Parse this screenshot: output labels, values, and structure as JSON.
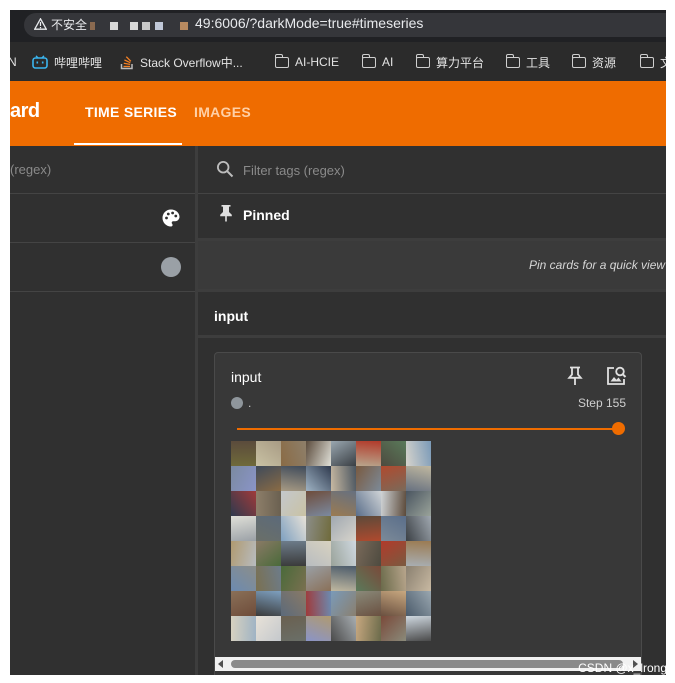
{
  "browser": {
    "security_label": "不安全",
    "url_text": "49:6006/?darkMode=true#timeseries",
    "bookmarks": [
      {
        "label": "N",
        "icon": "partial-icon"
      },
      {
        "label": "哔哩哔哩",
        "icon": "bilibili-icon"
      },
      {
        "label": "Stack Overflow中...",
        "icon": "stackoverflow-icon"
      },
      {
        "label": "AI-HCIE",
        "icon": "folder-icon"
      },
      {
        "label": "AI",
        "icon": "folder-icon"
      },
      {
        "label": "算力平台",
        "icon": "folder-icon"
      },
      {
        "label": "工具",
        "icon": "folder-icon"
      },
      {
        "label": "资源",
        "icon": "folder-icon"
      },
      {
        "label": "文",
        "icon": "folder-icon"
      }
    ]
  },
  "header": {
    "brand": "ard",
    "tabs": [
      {
        "label": "TIME SERIES",
        "active": true
      },
      {
        "label": "IMAGES",
        "active": false
      }
    ],
    "accent": "#ef6c00"
  },
  "sidebar": {
    "filter_placeholder": "(regex)",
    "rows": [
      {
        "icon": "palette-icon"
      },
      {
        "icon": "run-color-dot",
        "color": "#9aa0a6"
      }
    ]
  },
  "main": {
    "filter_placeholder": "Filter tags (regex)",
    "pinned_label": "Pinned",
    "pinned_hint": "Pin cards for a quick view",
    "group_label": "input",
    "card": {
      "title": "input",
      "run_name": ".",
      "run_color": "#8f969c",
      "step_label": "Step 155",
      "slider_fraction": 1.0
    }
  },
  "watermark": "CSDN @x_lrong"
}
